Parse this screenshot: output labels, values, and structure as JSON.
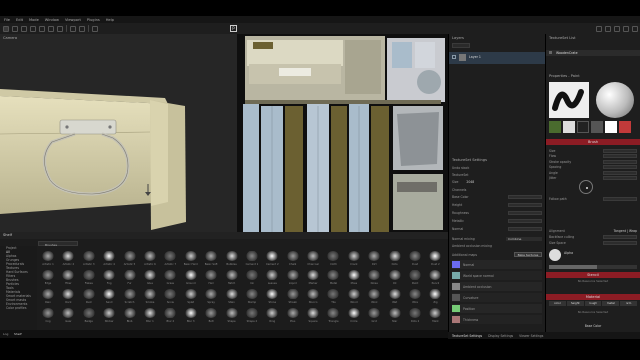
{
  "menu": [
    "File",
    "Edit",
    "Mode",
    "Window",
    "Viewport",
    "Plugins",
    "Help"
  ],
  "panels": {
    "viewport3d_title": "Camera",
    "shelf_title": "Shelf",
    "layers_title": "Layers",
    "layer_name": "Layer 1",
    "texture_set_list_title": "TextureSet List",
    "texture_set_name": "WoodenCrate",
    "texture_set_settings_title": "TextureSet Settings",
    "properties_title": "Properties - Paint"
  },
  "shelf": {
    "tabs": [
      "Brushes"
    ],
    "categories": [
      "Project",
      "All",
      "Alphas",
      "Grunges",
      "Procedurals",
      "Textures",
      "Hard Surfaces",
      "Filters",
      "Brushes",
      "Particles",
      "Tools",
      "Materials",
      "Smart materials",
      "Smart masks",
      "Environments",
      "Color profiles"
    ],
    "items": [
      "Artistic 1",
      "Artistic 2",
      "Artistic 3",
      "Artistic 4",
      "Artistic 5",
      "Artistic 6",
      "Artistic 7",
      "Basic Hard",
      "Basic Soft",
      "Bubbles",
      "Cement 1",
      "Cement 2",
      "Chalk",
      "Charcoal",
      "Cloth",
      "Crack",
      "Dirt",
      "Dots",
      "Dust",
      "Dust 2",
      "Edge",
      "Fiber",
      "Flakes",
      "Fog",
      "Fur",
      "Glue",
      "Grass",
      "Ground",
      "Hair",
      "Hatch",
      "Ink",
      "Leaves",
      "Liquid",
      "Marker",
      "Metal",
      "Moss",
      "Noise",
      "Oil",
      "Paint",
      "Pencil",
      "Rain",
      "Rock",
      "Rust",
      "Sand",
      "Scratch",
      "Smoke",
      "Snow",
      "Splat",
      "Spray",
      "Stain",
      "Stamp",
      "Stone",
      "Streak",
      "Stucco",
      "Tile",
      "Wood",
      "Wool",
      "Wet",
      "Wire",
      "Zig",
      "Cog",
      "Gear",
      "Badge",
      "Sticker",
      "Blob",
      "Blur 1",
      "Blur 2",
      "Blur 3",
      "Bolt",
      "Shape",
      "Shape 2",
      "Ring",
      "Plus",
      "Square",
      "Triangle",
      "Circle",
      "Grid",
      "Star",
      "Dots 2",
      "Mark"
    ]
  },
  "texture_set": {
    "undo_label": "Undo stack",
    "texset_label": "TextureSet",
    "size_label": "Size",
    "size_value": "2048",
    "channels_title": "Channels",
    "channels": [
      "Base Color",
      "Height",
      "Roughness",
      "Metallic",
      "Normal"
    ],
    "normal_mixing_label": "Normal mixing",
    "normal_mixing_value": "Combine",
    "ao_mixing_label": "Ambient occlusion mixing",
    "additional_maps_label": "Additional maps",
    "bake_textures_label": "Bake textures",
    "maps": [
      "Normal",
      "World space normal",
      "Ambient occlusion",
      "Curvature",
      "Position",
      "Thickness"
    ]
  },
  "properties": {
    "brush_label": "Brush",
    "params": [
      "Size",
      "Flow",
      "Stroke opacity",
      "Spacing",
      "Angle",
      "Jitter"
    ],
    "follow_path_label": "Follow path",
    "alignment_label": "Alignment",
    "alignment_value": "Tangent | Wrap",
    "backface_label": "Backface culling",
    "size_space_label": "Size Space",
    "alpha_label": "Alpha",
    "stencil_label": "Stencil",
    "material_label": "Material",
    "material_channels": [
      "color",
      "height",
      "rough",
      "metal",
      "nrm"
    ],
    "base_color_label": "Base Color",
    "no_resource": "No Resource Selected"
  },
  "bottom_tabs": [
    "TextureSet Settings",
    "Display Settings",
    "Viewer Settings"
  ],
  "status_items": [
    "Log",
    "Shelf"
  ],
  "colors": {
    "bg": "#1e1e1e",
    "header": "#2b2b2b",
    "accent_red": "#a5202c",
    "crate": "#d9d3ae",
    "uv_wood": "#6b6031",
    "uv_blue": "#a9bccb"
  }
}
